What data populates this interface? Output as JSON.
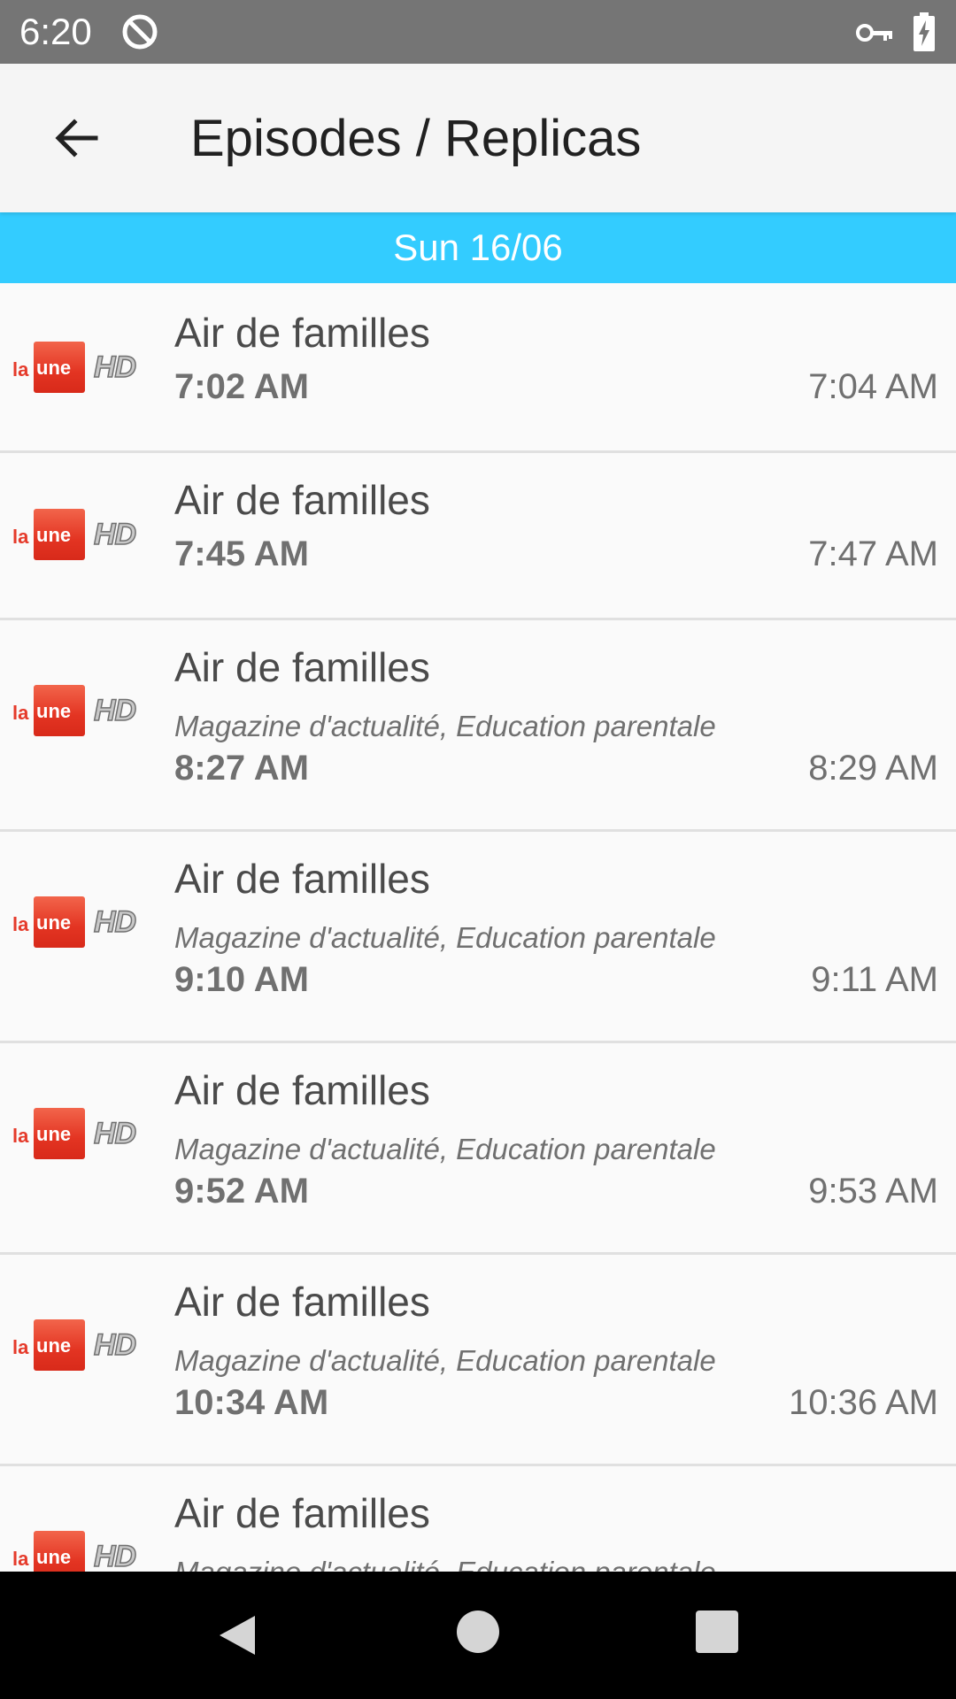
{
  "status_bar": {
    "time": "6:20",
    "icons": [
      "sync-icon",
      "vpn-key-icon",
      "battery-charging-icon"
    ]
  },
  "app_bar": {
    "back_icon": "arrow-left-icon",
    "title": "Episodes / Replicas"
  },
  "date_header": "Sun 16/06",
  "channel_logo": {
    "la": "la",
    "une": "une",
    "hd": "HD"
  },
  "episodes": [
    {
      "title": "Air de familles",
      "genre": "",
      "start": "7:02 AM",
      "end": "7:04 AM"
    },
    {
      "title": "Air de familles",
      "genre": "",
      "start": "7:45 AM",
      "end": "7:47 AM"
    },
    {
      "title": "Air de familles",
      "genre": "Magazine d'actualité, Education parentale",
      "start": "8:27 AM",
      "end": "8:29 AM"
    },
    {
      "title": "Air de familles",
      "genre": "Magazine d'actualité, Education parentale",
      "start": "9:10 AM",
      "end": "9:11 AM"
    },
    {
      "title": "Air de familles",
      "genre": "Magazine d'actualité, Education parentale",
      "start": "9:52 AM",
      "end": "9:53 AM"
    },
    {
      "title": "Air de familles",
      "genre": "Magazine d'actualité, Education parentale",
      "start": "10:34 AM",
      "end": "10:36 AM"
    },
    {
      "title": "Air de familles",
      "genre": "Magazine d'actualité, Education parentale",
      "start": "",
      "end": ""
    }
  ],
  "colors": {
    "status_bar": "#757575",
    "date_header": "#33ccff",
    "logo_red": "#e33422"
  },
  "nav_bar": {
    "icons": [
      "back-triangle-icon",
      "home-circle-icon",
      "recents-square-icon"
    ]
  }
}
